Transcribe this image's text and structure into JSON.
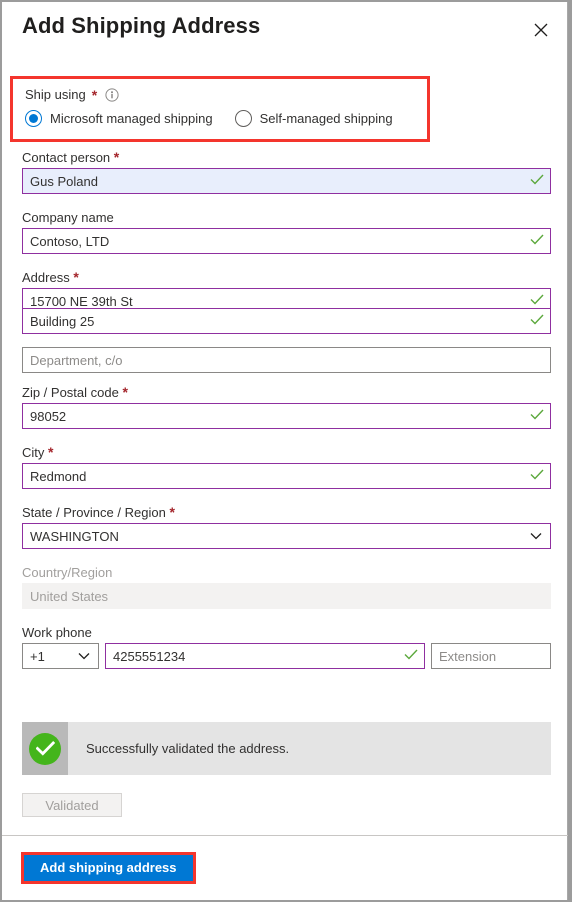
{
  "dialog": {
    "title": "Add Shipping Address",
    "close_icon": "close-icon"
  },
  "ship_using": {
    "label": "Ship using",
    "required_marker": "*",
    "info_icon": "info-icon",
    "options": [
      {
        "label": "Microsoft managed shipping",
        "selected": true
      },
      {
        "label": "Self-managed shipping",
        "selected": false
      }
    ]
  },
  "fields": {
    "contact_person": {
      "label": "Contact person",
      "required_marker": "*",
      "value": "Gus Poland",
      "state": "valid-autofill"
    },
    "company_name": {
      "label": "Company name",
      "value": "Contoso, LTD",
      "state": "valid"
    },
    "address": {
      "label": "Address",
      "required_marker": "*",
      "line1": "15700 NE 39th St",
      "line2": "Building 25",
      "line3_placeholder": "Department, c/o",
      "line3_value": ""
    },
    "zip": {
      "label": "Zip / Postal code",
      "required_marker": "*",
      "value": "98052",
      "state": "valid"
    },
    "city": {
      "label": "City",
      "required_marker": "*",
      "value": "Redmond",
      "state": "valid"
    },
    "state_province": {
      "label": "State / Province / Region",
      "required_marker": "*",
      "value": "WASHINGTON",
      "state": "valid-dropdown"
    },
    "country_region": {
      "label": "Country/Region",
      "value": "United States",
      "state": "disabled"
    },
    "work_phone": {
      "label": "Work phone",
      "country_code": "+1",
      "number": "4255551234",
      "extension_placeholder": "Extension",
      "extension_value": ""
    }
  },
  "validation": {
    "message": "Successfully validated the address.",
    "icon": "success-check-icon",
    "button_label": "Validated"
  },
  "footer": {
    "primary_label": "Add shipping address"
  },
  "colors": {
    "accent_blue": "#0078d4",
    "highlight_red": "#f4352d",
    "valid_border_purple": "#8f2fa0",
    "success_green": "#44b51b",
    "required_red": "#a4262c",
    "autofill_bg": "#e8eefc"
  }
}
